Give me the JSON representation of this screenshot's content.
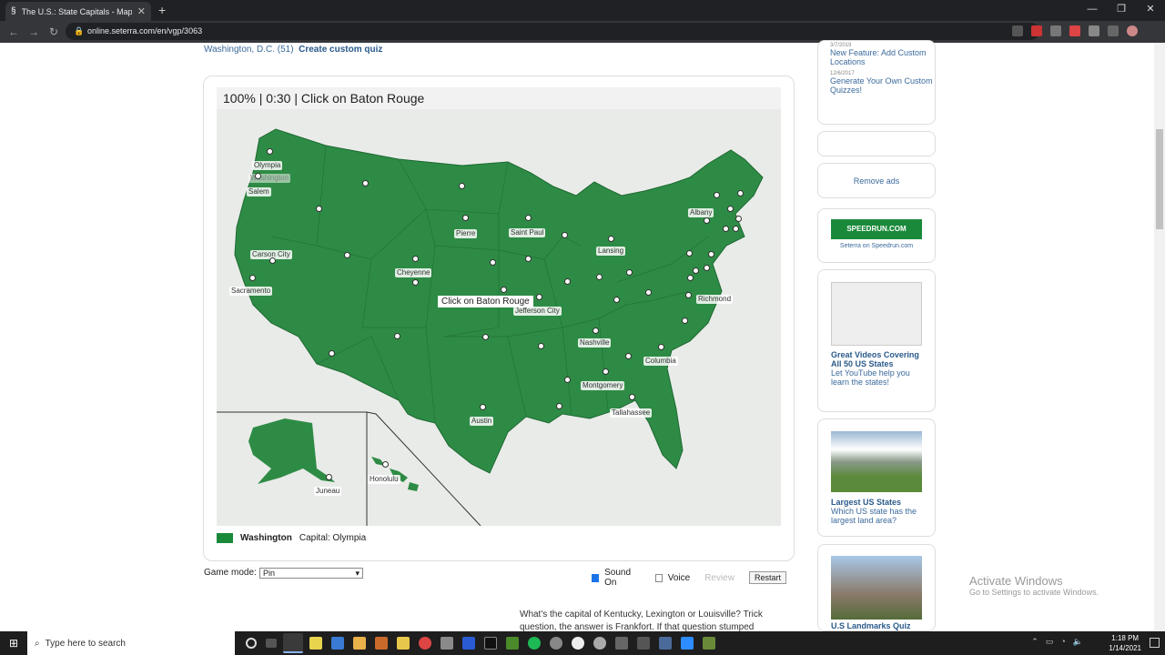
{
  "browser": {
    "tab_title": "The U.S.: State Capitals - Map",
    "url": "online.seterra.com/en/vgp/3063",
    "window_controls": [
      "—",
      "❐",
      "✕"
    ]
  },
  "breadcrumb": {
    "left": "Washington, D.C. (51)",
    "right": "Create custom quiz"
  },
  "quiz": {
    "question": "100%  |  0:30  |  Click on Baton Rouge",
    "hint_label": "Click on Baton Rouge",
    "status_state": "Washington",
    "status_capital": "Capital: Olympia",
    "map_labels": {
      "olympia": "Olympia",
      "washington": "Washington",
      "salem": "Salem",
      "carson": "Carson City",
      "sacramento": "Sacramento",
      "cheyenne": "Cheyenne",
      "pierre": "Pierre",
      "saintpaul": "Saint Paul",
      "lansing": "Lansing",
      "albany": "Albany",
      "richmond": "Richmond",
      "jefferson": "Jefferson City",
      "nashville": "Nashville",
      "columbia": "Columbia",
      "montgomery": "Montgomery",
      "tallahassee": "Tallahassee",
      "austin": "Austin",
      "juneau": "Juneau",
      "honolulu": "Honolulu"
    }
  },
  "controls": {
    "game_mode_label": "Game mode:",
    "game_mode_value": "Pin",
    "sound_label": "Sound On",
    "voice_label": "Voice",
    "review_label": "Review",
    "restart_label": "Restart"
  },
  "promo_text": "What's the capital of Kentucky, Lexington or Louisville? Trick question, the answer is Frankfort. If that question stumped",
  "sidebar": {
    "news": [
      {
        "date": "3/7/2019",
        "title": "New Feature: Add Custom Locations"
      },
      {
        "date": "12/6/2017",
        "title": "Generate Your Own Custom Quizzes!"
      }
    ],
    "remove_ads": "Remove ads",
    "speedrun_logo": "SPEEDRUN.COM",
    "speedrun_caption": "Seterra on Speedrun.com",
    "videos_title": "Great Videos Covering All 50 US States",
    "videos_desc": "Let YouTube help you learn the states!",
    "largest_title": "Largest US States",
    "largest_desc": "Which US state has the largest land area?",
    "landmarks_title": "U.S Landmarks Quiz"
  },
  "watermark": {
    "title": "Activate Windows",
    "subtitle": "Go to Settings to activate Windows."
  },
  "taskbar": {
    "search_placeholder": "Type here to search",
    "time": "1:18 PM",
    "date": "1/14/2021"
  }
}
